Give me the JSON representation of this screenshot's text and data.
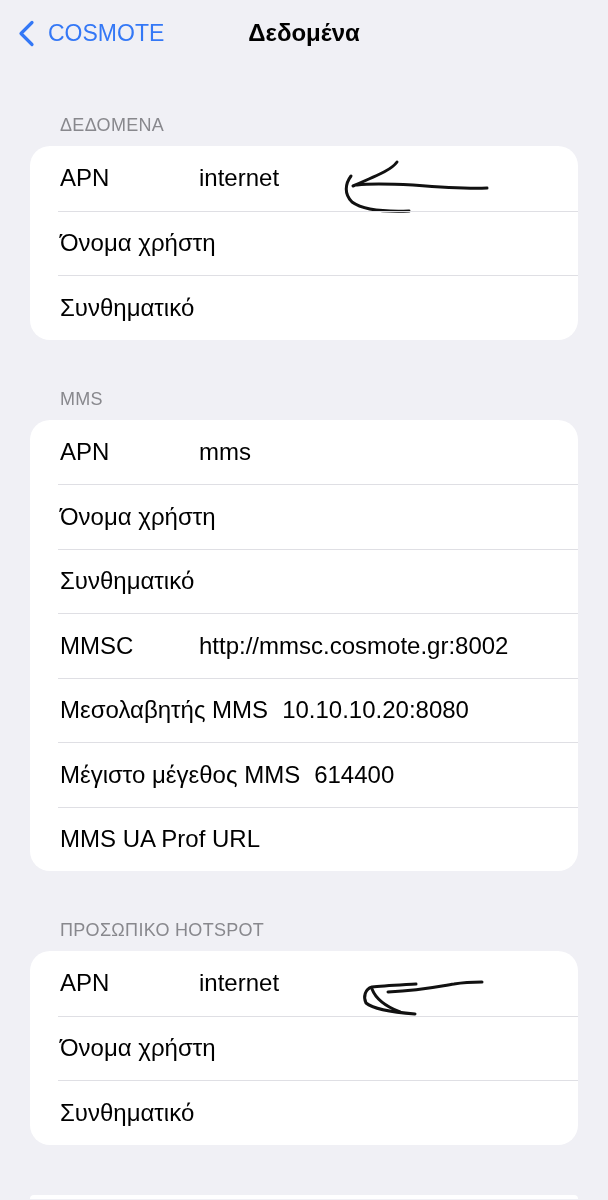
{
  "nav_bar": {
    "back_label": "COSMOTE",
    "title": "Δεδομένα"
  },
  "sections": [
    {
      "header": "ΔΕΔΟΜΕΝΑ",
      "rows": [
        {
          "label": "APN",
          "value": "internet",
          "marked": true
        },
        {
          "label": "Όνομα χρήστη",
          "marked": false
        },
        {
          "label": "Συνθηματικό",
          "marked": false
        }
      ]
    },
    {
      "header": "MMS",
      "rows": [
        {
          "label": "APN",
          "value": "mms",
          "marked": false
        },
        {
          "label": "Όνομα χρήστη",
          "marked": false
        },
        {
          "label": "Συνθηματικό",
          "marked": false
        },
        {
          "label": "MMSC",
          "value": "http://mmsc.cosmote.gr:8002",
          "marked": false
        },
        {
          "label": "Μεσολαβητής MMS",
          "value": "10.10.10.20:8080",
          "marked": false
        },
        {
          "label": "Μέγιστο μέγεθος MMS",
          "value": "614400",
          "marked": false
        },
        {
          "label": "MMS UA Prof URL",
          "marked": false
        }
      ]
    },
    {
      "header": "ΠΡΟΣΩΠΙΚΟ HOTSPOT",
      "rows": [
        {
          "label": "APN",
          "value": "internet",
          "marked": true
        },
        {
          "label": "Όνομα χρήστη",
          "marked": false
        },
        {
          "label": "Συνθηματικό",
          "marked": false
        }
      ]
    }
  ]
}
